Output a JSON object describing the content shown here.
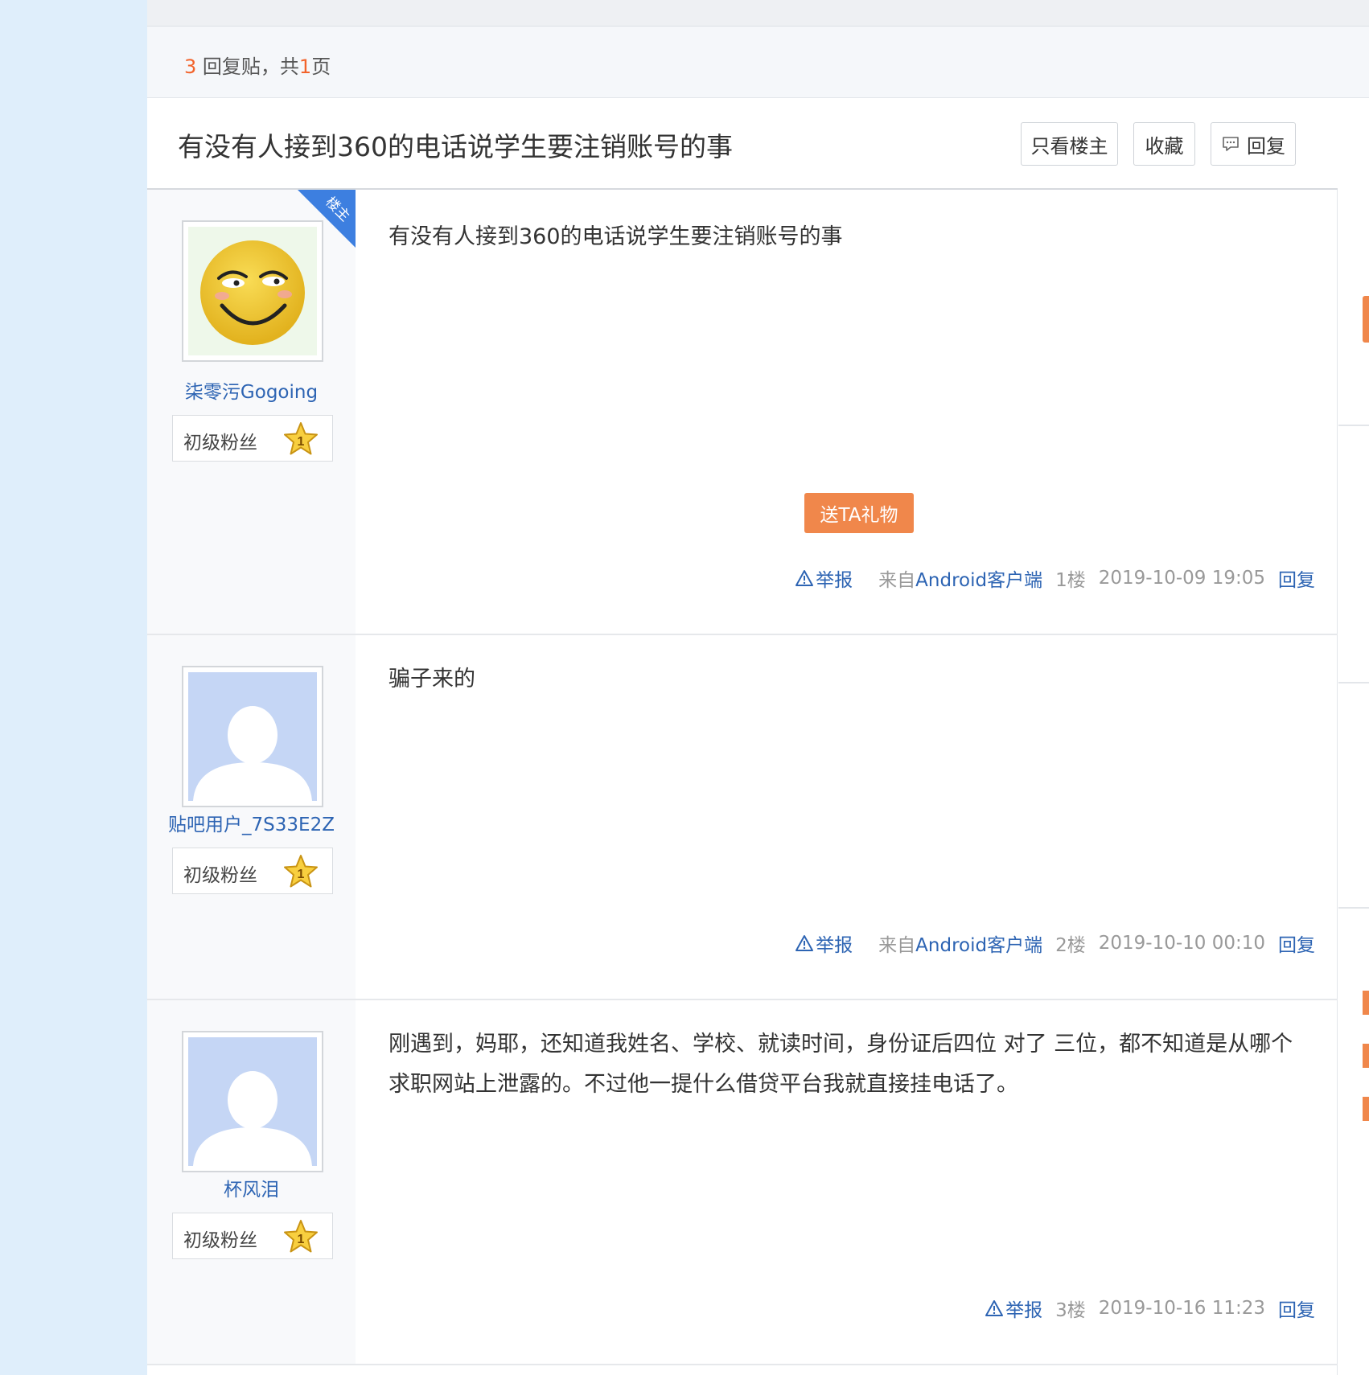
{
  "pager": {
    "reply_count": "3",
    "reply_label": " 回复贴，共",
    "page_count": "1",
    "page_label": "页"
  },
  "thread": {
    "title": "有没有人接到360的电话说学生要注销账号的事",
    "buttons": {
      "only_host": "只看楼主",
      "favorite": "收藏",
      "reply": "回复"
    }
  },
  "host_ribbon_label": "楼主",
  "gift_button": "送TA礼物",
  "posts": [
    {
      "username": "柒零污Gogoing",
      "fan_level_label": "初级粉丝",
      "fan_level": "1",
      "content": "有没有人接到360的电话说学生要注销账号的事",
      "report": "举报",
      "source_prefix": "来自",
      "source_link": "Android客户端",
      "floor": "1楼",
      "time": "2019-10-09 19:05",
      "reply": "回复"
    },
    {
      "username": "贴吧用户_7S33E2Z",
      "fan_level_label": "初级粉丝",
      "fan_level": "1",
      "content": "骗子来的",
      "report": "举报",
      "source_prefix": "来自",
      "source_link": "Android客户端",
      "floor": "2楼",
      "time": "2019-10-10 00:10",
      "reply": "回复"
    },
    {
      "username": "杯风泪",
      "fan_level_label": "初级粉丝",
      "fan_level": "1",
      "content": "刚遇到，妈耶，还知道我姓名、学校、就读时间，身份证后四位 对了 三位，都不知道是从哪个求职网站上泄露的。不过他一提什么借贷平台我就直接挂电话了。",
      "report": "举报",
      "floor": "3楼",
      "time": "2019-10-16 11:23",
      "reply": "回复"
    }
  ],
  "colors": {
    "accent_orange": "#f0874b",
    "link_blue": "#2d64b3",
    "count_orange": "#f2632b",
    "ribbon_blue": "#3d7fe0",
    "default_avatar_bg": "#c5d6f5"
  }
}
